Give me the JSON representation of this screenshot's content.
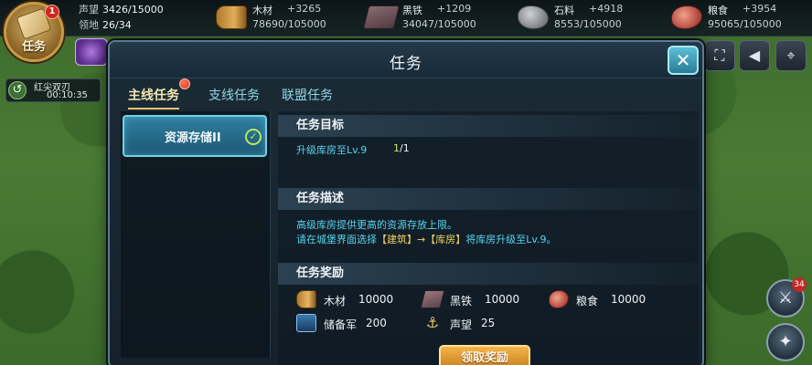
{
  "player": {
    "avatar_label": "任务",
    "notification_count": "1",
    "prestige_label": "声望",
    "prestige_value": "3426/15000",
    "territory_label": "领地",
    "territory_value": "26/34"
  },
  "resources": [
    {
      "icon": "wood-icon",
      "name": "木材",
      "delta": "+3265",
      "amount": "78690/105000"
    },
    {
      "icon": "iron-icon",
      "name": "黑铁",
      "delta": "+1209",
      "amount": "34047/105000"
    },
    {
      "icon": "stone-icon",
      "name": "石料",
      "delta": "+4918",
      "amount": "8553/105000"
    },
    {
      "icon": "food-icon",
      "name": "粮食",
      "delta": "+3954",
      "amount": "95065/105000"
    }
  ],
  "timer": {
    "name": "红尖双刃",
    "time": "00:10:35"
  },
  "right_badge_count": "34",
  "dialog": {
    "title": "任务",
    "close_label": "✕",
    "tabs": [
      {
        "label": "主线任务",
        "active": true
      },
      {
        "label": "支线任务",
        "active": false
      },
      {
        "label": "联盟任务",
        "active": false
      }
    ],
    "quest_list": [
      {
        "label": "资源存储II",
        "completed": true
      }
    ],
    "goal": {
      "header": "任务目标",
      "text": "升级库房至Lv.9",
      "progress_current": "1",
      "progress_total": "/1"
    },
    "description": {
      "header": "任务描述",
      "line1": "高级库房提供更高的资源存放上限。",
      "line2_a": "请在城堡界面选择",
      "line2_b": "【建筑】→【库房】",
      "line2_c": "将库房升级至Lv.9。"
    },
    "rewards": {
      "header": "任务奖励",
      "items": [
        {
          "icon": "wood-icon",
          "name": "木材",
          "value": "10000"
        },
        {
          "icon": "iron-icon",
          "name": "黑铁",
          "value": "10000"
        },
        {
          "icon": "food-icon",
          "name": "粮食",
          "value": "10000"
        },
        {
          "icon": "reserve-army-icon",
          "name": "储备军",
          "value": "200"
        },
        {
          "icon": "prestige-icon",
          "name": "声望",
          "value": "25"
        }
      ]
    },
    "claim_button": "领取奖励"
  },
  "colors": {
    "accent_cyan": "#5ad3f0",
    "highlight_yellow": "#f0d060",
    "progress_green": "#c8ec6a",
    "claim_orange": "#e29a32"
  }
}
